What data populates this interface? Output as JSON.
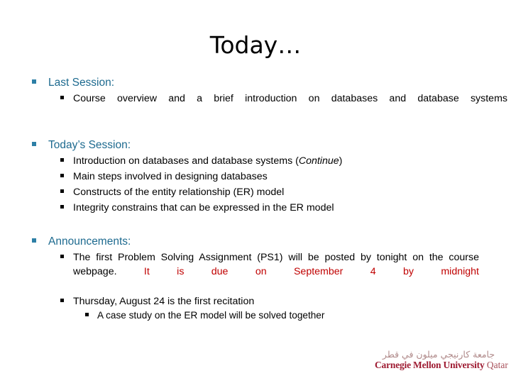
{
  "slide": {
    "title": "Today…",
    "sections": [
      {
        "id": "last-session",
        "heading": "Last Session:",
        "items": [
          "Course overview and a brief introduction on databases and database systems"
        ]
      },
      {
        "id": "todays-session",
        "heading": "Today’s Session:",
        "items": [
          {
            "text_before": "Introduction on databases and database systems (",
            "emphasis": "Continue",
            "text_after": ")"
          },
          "Main steps involved in designing databases",
          "Constructs of the entity relationship (ER) model",
          "Integrity constrains that can be expressed in the ER model"
        ]
      },
      {
        "id": "announcements",
        "heading": "Announcements:",
        "items": [
          {
            "text_before": "The first Problem Solving Assignment (PS1) will be posted by tonight on the course webpage. ",
            "highlight": "It is due on September 4 by midnight",
            "text_after": ""
          },
          "Thursday, August 24 is the first recitation"
        ],
        "subitems": [
          "A case study on the ER model will be solved together"
        ]
      }
    ]
  },
  "logo": {
    "arabic": "جامعة كارنيجي ميلون في قطر",
    "name_bold": "Carnegie Mellon University",
    "name_light": " Qatar"
  },
  "colors": {
    "heading_teal": "#1D6A8F",
    "bullet_teal": "#2D7FA6",
    "highlight_red": "#C00000",
    "logo_red": "#9E1B32",
    "background": "#FFFFFF",
    "body_text": "#000000"
  }
}
